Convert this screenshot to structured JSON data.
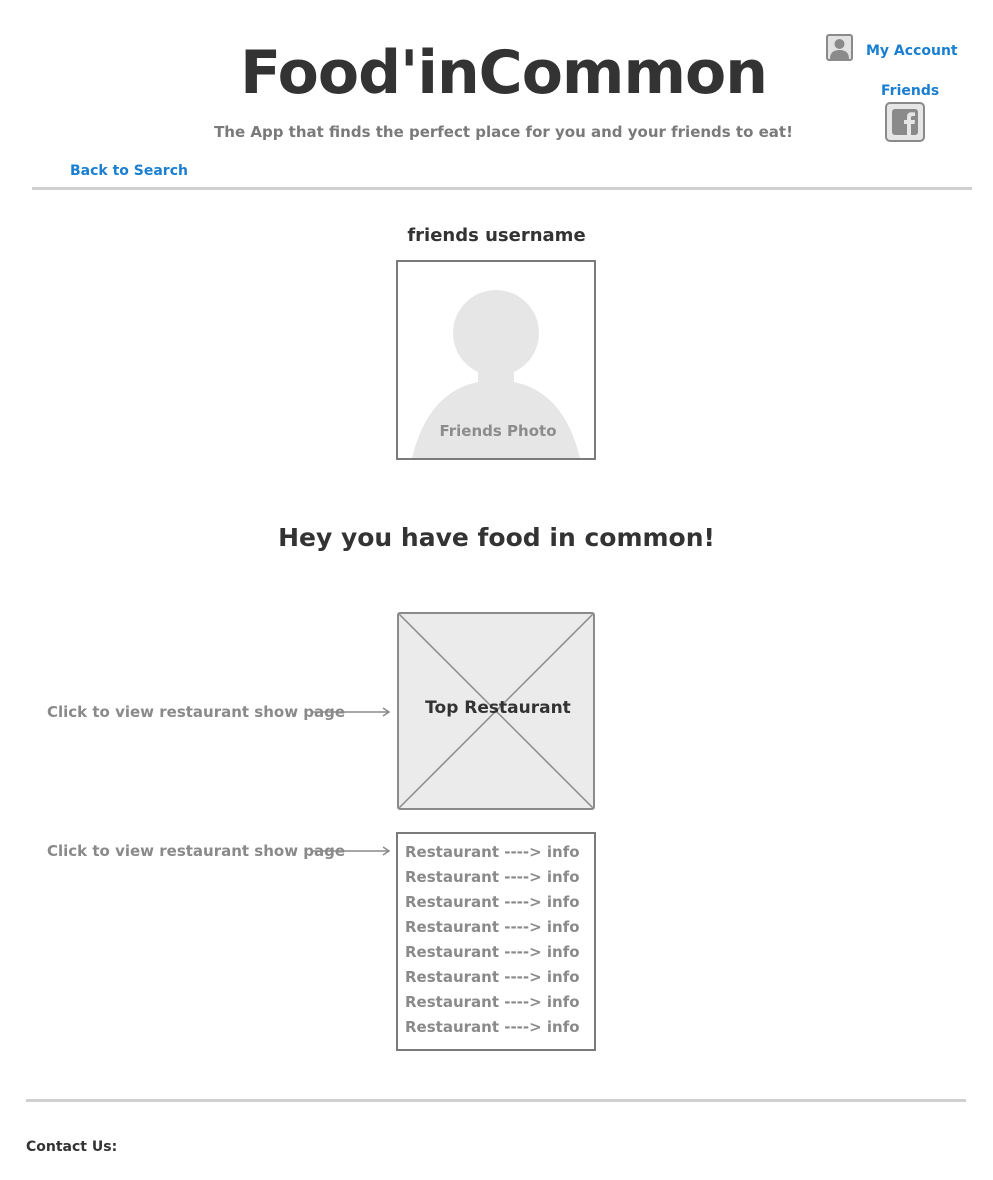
{
  "header": {
    "title": "Food'inCommon",
    "tagline": "The App that finds the perfect place for you and your friends to eat!",
    "my_account_label": "My Account",
    "friends_label": "Friends",
    "back_label": "Back to Search"
  },
  "friend": {
    "username": "friends username",
    "photo_label": "Friends Photo"
  },
  "main": {
    "heading": "Hey you have food in common!",
    "hint_top": "Click to view restaurant show page",
    "hint_list": "Click to view restaurant show page",
    "top_restaurant_label": "Top Restaurant",
    "restaurants": [
      "Restaurant ----> info",
      "Restaurant ----> info",
      "Restaurant ----> info",
      "Restaurant ----> info",
      "Restaurant ----> info",
      "Restaurant ----> info",
      "Restaurant ----> info",
      "Restaurant ----> info"
    ]
  },
  "footer": {
    "contact_label": "Contact Us:"
  },
  "colors": {
    "link": "#1a7fd1",
    "text": "#333333",
    "muted": "#8a8a8a",
    "divider": "#cfcfcf",
    "placeholder_fill": "#ebebeb"
  },
  "icons": [
    "user-icon",
    "facebook-icon",
    "arrow-right-icon",
    "image-placeholder-icon"
  ]
}
